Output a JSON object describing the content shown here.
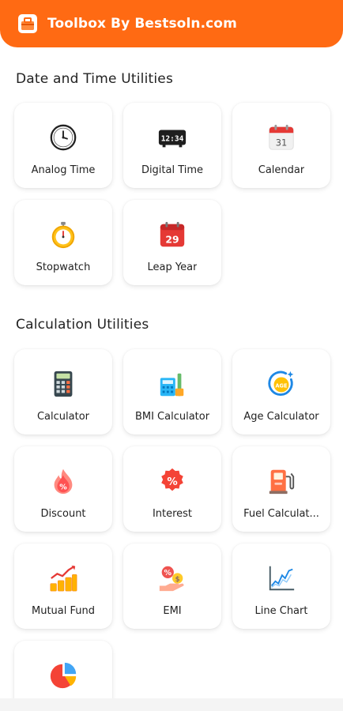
{
  "app": {
    "title": "Toolbox By Bestsoln.com"
  },
  "sections": [
    {
      "title": "Date and Time Utilities",
      "items": [
        {
          "label": "Analog Time",
          "icon": "analog-clock-icon"
        },
        {
          "label": "Digital Time",
          "icon": "digital-clock-icon"
        },
        {
          "label": "Calendar",
          "icon": "calendar-icon"
        },
        {
          "label": "Stopwatch",
          "icon": "stopwatch-icon"
        },
        {
          "label": "Leap Year",
          "icon": "leap-year-calendar-icon"
        }
      ]
    },
    {
      "title": "Calculation Utilities",
      "items": [
        {
          "label": "Calculator",
          "icon": "calculator-icon"
        },
        {
          "label": "BMI Calculator",
          "icon": "bmi-calculator-icon"
        },
        {
          "label": "Age Calculator",
          "icon": "age-calculator-icon"
        },
        {
          "label": "Discount",
          "icon": "discount-icon"
        },
        {
          "label": "Interest",
          "icon": "interest-icon"
        },
        {
          "label": "Fuel Calculat...",
          "icon": "fuel-pump-icon"
        },
        {
          "label": "Mutual Fund",
          "icon": "mutual-fund-icon"
        },
        {
          "label": "EMI",
          "icon": "emi-icon"
        },
        {
          "label": "Line Chart",
          "icon": "line-chart-icon"
        },
        {
          "label": "",
          "icon": "pie-chart-icon"
        }
      ]
    }
  ],
  "date_icons": {
    "calendar_day": "31",
    "leap_day": "29",
    "digital_time": "12:34"
  },
  "icons": {
    "age_badge": "AGE"
  },
  "colors": {
    "accent": "#ff6a13"
  }
}
